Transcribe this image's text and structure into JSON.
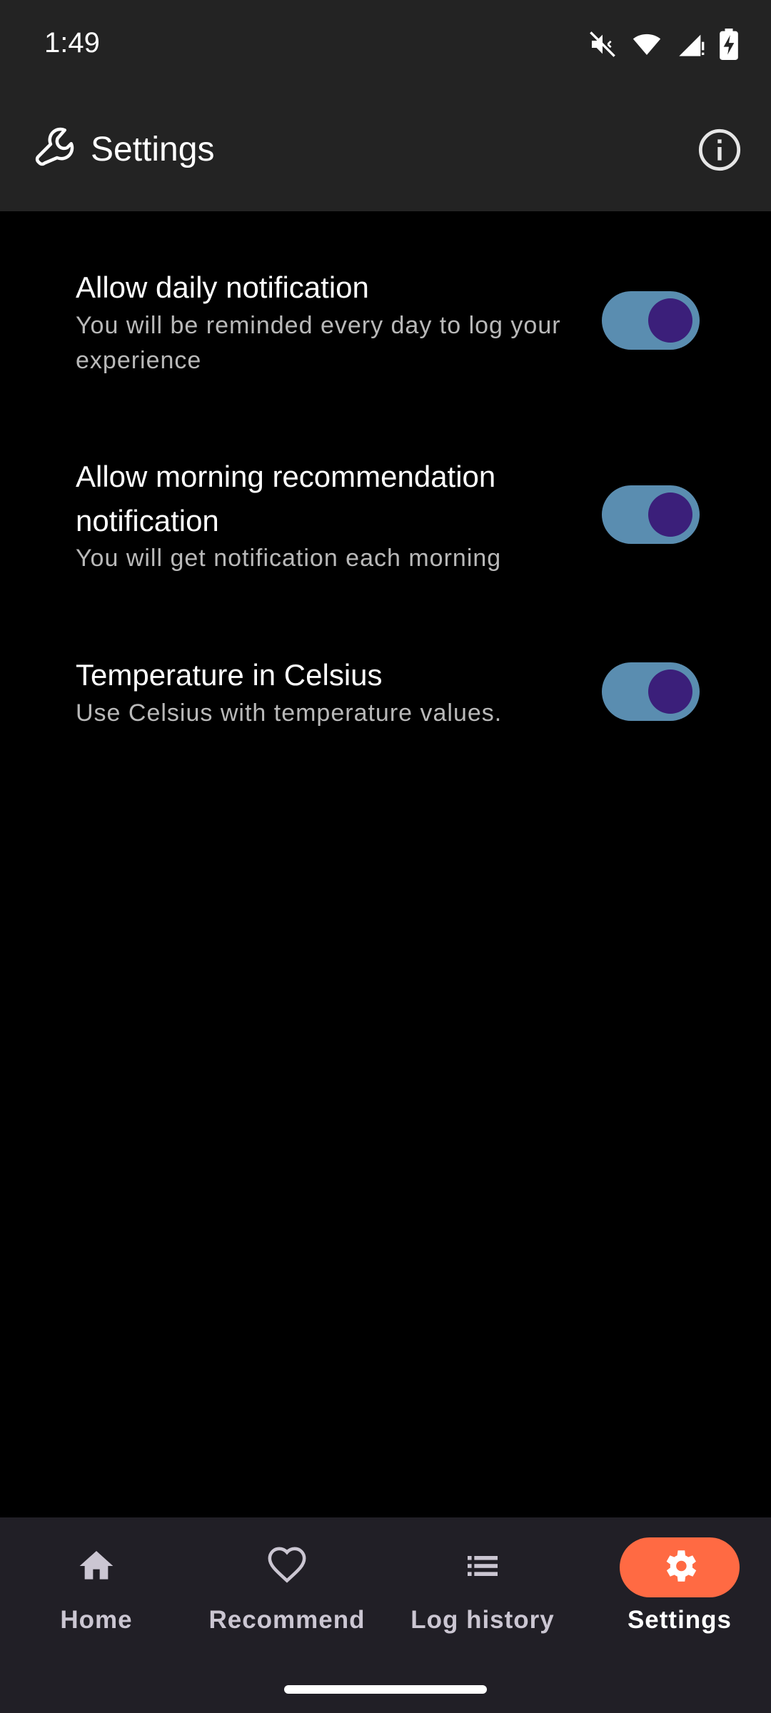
{
  "status_bar": {
    "time": "1:49",
    "icons": [
      "mute-icon",
      "wifi-icon",
      "signal-icon",
      "battery-charging-icon"
    ]
  },
  "app_bar": {
    "icon": "wrench-icon",
    "title": "Settings",
    "info_icon": "info-icon"
  },
  "settings": [
    {
      "title": "Allow daily notification",
      "description": "You will be reminded every day to log your experience",
      "enabled": true
    },
    {
      "title": "Allow morning recommendation notification",
      "description": "You will get notification each morning",
      "enabled": true
    },
    {
      "title": "Temperature in Celsius",
      "description": "Use Celsius with temperature values.",
      "enabled": true
    }
  ],
  "bottom_nav": {
    "items": [
      {
        "label": "Home",
        "icon": "home-icon",
        "active": false
      },
      {
        "label": "Recommend",
        "icon": "heart-icon",
        "active": false
      },
      {
        "label": "Log history",
        "icon": "list-icon",
        "active": false
      },
      {
        "label": "Settings",
        "icon": "gear-icon",
        "active": true
      }
    ]
  },
  "colors": {
    "bar_background": "#232323",
    "page_background": "#000000",
    "toggle_track": "#5a8db0",
    "toggle_thumb": "#3b1f7a",
    "nav_background": "#211f26",
    "nav_active_indicator": "#ff6a43"
  }
}
